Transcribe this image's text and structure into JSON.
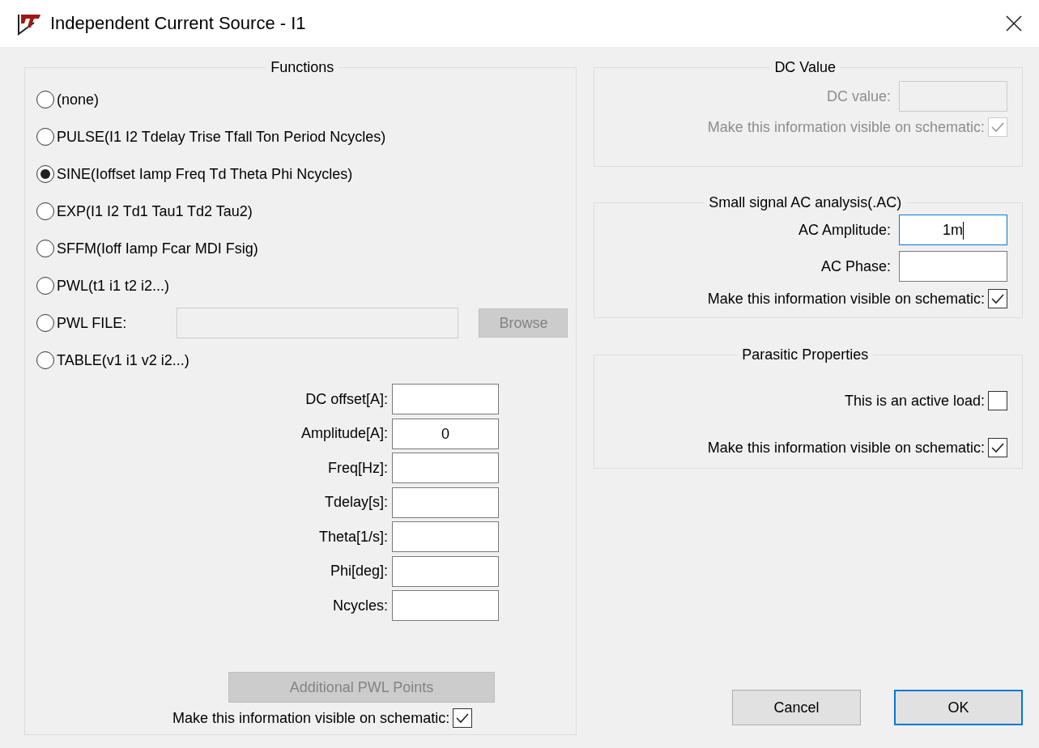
{
  "window": {
    "title": "Independent Current Source - I1"
  },
  "functions": {
    "title": "Functions",
    "options": [
      {
        "kind": "plain",
        "label": "(none)",
        "selected": false
      },
      {
        "kind": "plain",
        "label": "PULSE(I1 I2 Tdelay Trise Tfall Ton Period Ncycles)",
        "selected": false
      },
      {
        "kind": "plain",
        "label": "SINE(Ioffset Iamp Freq Td Theta Phi Ncycles)",
        "selected": true
      },
      {
        "kind": "plain",
        "label": "EXP(I1 I2 Td1 Tau1 Td2 Tau2)",
        "selected": false
      },
      {
        "kind": "plain",
        "label": "SFFM(Ioff Iamp Fcar MDI Fsig)",
        "selected": false
      },
      {
        "kind": "plain",
        "label": "PWL(t1 i1 t2 i2...)",
        "selected": false
      },
      {
        "kind": "file",
        "label": "PWL FILE:",
        "selected": false,
        "field_disabled": true,
        "browse": {
          "label": "Browse",
          "disabled": true
        }
      },
      {
        "kind": "plain",
        "label": "TABLE(v1 i1 v2 i2...)",
        "selected": false
      }
    ],
    "parameters": [
      {
        "label": "DC offset[A]:"
      },
      {
        "label": "Amplitude[A]:",
        "value": "0"
      },
      {
        "label": "Freq[Hz]:"
      },
      {
        "label": "Tdelay[s]:"
      },
      {
        "label": "Theta[1/s]:"
      },
      {
        "label": "Phi[deg]:"
      },
      {
        "label": "Ncycles:"
      }
    ],
    "additional_button": {
      "label": "Additional PWL Points",
      "disabled": true
    },
    "visible_check": {
      "label": "Make this information visible on schematic:",
      "checked": true,
      "disabled": false
    }
  },
  "dc_value": {
    "title": "DC Value",
    "fields": [
      {
        "label": "DC value:",
        "disabled": true,
        "focused": false
      }
    ],
    "checks": [
      {
        "label": "Make this information visible on schematic:",
        "checked": true,
        "disabled": true
      }
    ]
  },
  "ac_analysis": {
    "title": "Small signal AC analysis(.AC)",
    "fields": [
      {
        "label": "AC Amplitude:",
        "value": "1m",
        "disabled": false,
        "focused": true
      },
      {
        "label": "AC Phase:",
        "disabled": false,
        "focused": false
      }
    ],
    "checks": [
      {
        "label": "Make this information visible on schematic:",
        "checked": true,
        "disabled": false
      }
    ]
  },
  "parasitic": {
    "title": "Parasitic Properties",
    "checks": [
      {
        "label": "This is an active load:",
        "checked": false,
        "disabled": false
      },
      {
        "label": "Make this information visible on schematic:",
        "checked": true,
        "disabled": false
      }
    ]
  },
  "buttons": [
    {
      "label": "Cancel",
      "default": false
    },
    {
      "label": "OK",
      "default": true
    }
  ]
}
